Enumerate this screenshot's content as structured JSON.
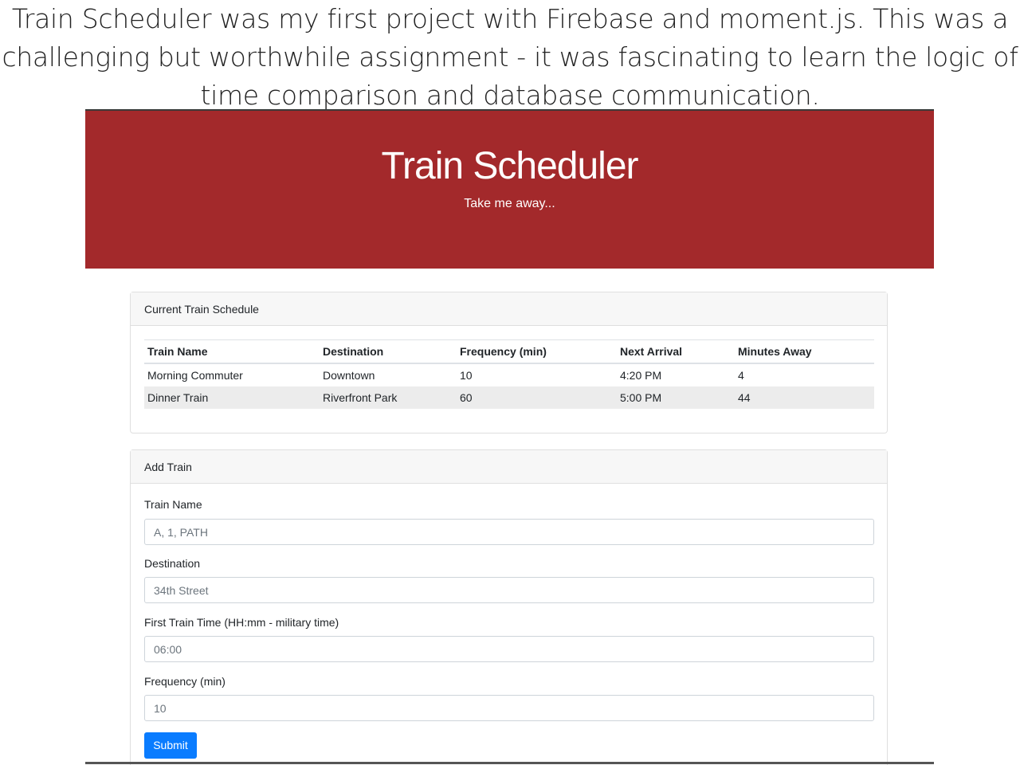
{
  "caption": {
    "lines": [
      "Train Scheduler was my first project with Firebase and moment.js.  This was a",
      "challenging but worthwhile assignment - it was fascinating to learn the logic of",
      "time comparison and database communication."
    ]
  },
  "jumbotron": {
    "title": "Train Scheduler",
    "subtitle": "Take me away..."
  },
  "schedule": {
    "header": "Current Train Schedule",
    "columns": [
      "Train Name",
      "Destination",
      "Frequency (min)",
      "Next Arrival",
      "Minutes Away"
    ],
    "rows": [
      [
        "Morning Commuter",
        "Downtown",
        "10",
        "4:20 PM",
        "4"
      ],
      [
        "Dinner Train",
        "Riverfront Park",
        "60",
        "5:00 PM",
        "44"
      ]
    ]
  },
  "add_train": {
    "header": "Add Train",
    "fields": [
      {
        "label": "Train Name",
        "placeholder": "A, 1, PATH"
      },
      {
        "label": "Destination",
        "placeholder": "34th Street"
      },
      {
        "label": "First Train Time (HH:mm - military time)",
        "placeholder": "06:00"
      },
      {
        "label": "Frequency (min)",
        "placeholder": "10"
      }
    ],
    "submit_label": "Submit"
  },
  "colors": {
    "jumbotron_bg": "#a3292b",
    "submit_bg": "#0a7cff"
  }
}
